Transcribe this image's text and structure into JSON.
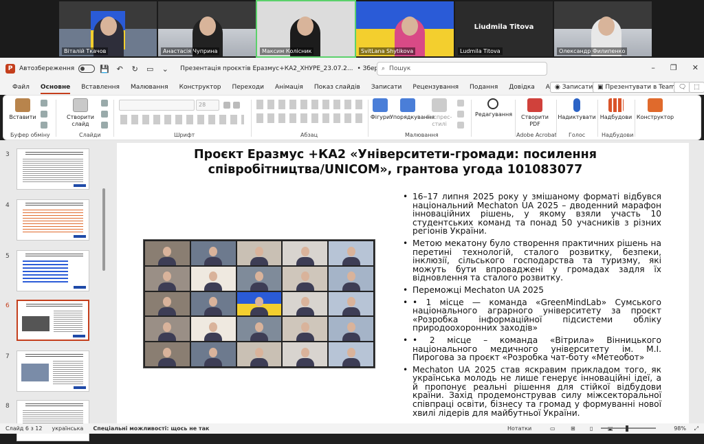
{
  "meeting": {
    "participants": [
      {
        "name": "Віталій Ткачов"
      },
      {
        "name": "Анастасія Чуприна"
      },
      {
        "name": "Максим Колісник"
      },
      {
        "name": "SvitLana Shytikova"
      },
      {
        "name": "Ludmila Titova"
      },
      {
        "name": "Олександр Филипенко"
      }
    ],
    "plain_tile_name": "Liudmila Titova"
  },
  "titlebar": {
    "autosave_label": "Автозбереження",
    "doc_title": "Презентація проєктів Еразмус+КА2_ХНУРЕ_23.07.2...",
    "saved_status": "• Збережено у цей ПК ⌄",
    "search_placeholder": "Пошук"
  },
  "tabs": {
    "items": [
      "Файл",
      "Основне",
      "Вставлення",
      "Малювання",
      "Конструктор",
      "Переходи",
      "Анімація",
      "Показ слайдів",
      "Записати",
      "Рецензування",
      "Подання",
      "Довідка",
      "Acrobat"
    ],
    "active": "Основне",
    "record_btn": "Записати",
    "present_btn": "Презентувати в Teams"
  },
  "ribbon": {
    "paste": "Вставити",
    "clipboard_group": "Буфер обміну",
    "new_slide": "Створити слайд",
    "slides_group": "Слайди",
    "font_group": "Шрифт",
    "font_size": "28",
    "paragraph_group": "Абзац",
    "shapes": "Фігури",
    "arrange": "Упорядкування",
    "quick_styles": "Експрес-стилі",
    "drawing_group": "Малювання",
    "editing": "Редагування",
    "create_pdf": "Створити PDF",
    "acrobat_group": "Adobe Acrobat",
    "dictate": "Надиктувати",
    "voice_group": "Голос",
    "addins": "Надбудови",
    "addins_group": "Надбудови",
    "designer": "Конструктор"
  },
  "thumbs": {
    "numbers": [
      "3",
      "4",
      "5",
      "6",
      "7",
      "8"
    ],
    "active": "6"
  },
  "slide": {
    "title": "Проєкт Еразмус +КА2 «Університети-громади: посилення співробітництва/UNICOM», грантова угода 101083077",
    "bullets": [
      "16–17 липня 2025 року у змішаному форматі відбувся національний Mechaton UA 2025 – дводенний марафон інноваційних рішень, у якому взяли участь 10 студентських команд та понад 50 учасників з різних регіонів України.",
      "Метою мекатону було створення практичних рішень на перетині технологій, сталого розвитку, безпеки, інклюзії, сільського господарства та туризму, які можуть бути впроваджені у громадах задля їх відновлення та сталого розвитку.",
      "Переможці Mechaton UA 2025",
      "•        1 місце — команда «GreenMindLab» Сумського національного аграрного університету за проєкт «Розробка інформаційної підсистеми обліку природоохоронних заходів»",
      "•        2 місце – команда «Вітрила» Вінницького національного медичного університету ім. М.І. Пирогова за проєкт «Розробка чат-боту «Метеобот»",
      "Mechaton UA 2025 став яскравим прикладом того, як українська молодь не лише генерує інноваційні ідеї, а й пропонує реальні рішення для стійкої відбудови країни. Захід продемонстрував силу міжсекторальної співпраці освіти, бізнесу та громад у формуванні нової хвилі лідерів для майбутньої України."
    ]
  },
  "status": {
    "slide_counter": "Слайд 6 з 12",
    "language": "українська",
    "accessibility": "Спеціальні можливості: щось не так",
    "notes": "Нотатки",
    "zoom": "98%"
  },
  "colors": {
    "accent": "#c43e1c"
  }
}
